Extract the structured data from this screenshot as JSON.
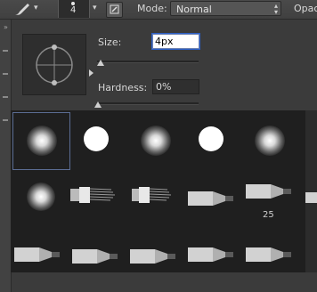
{
  "options_bar": {
    "tool_icon": "brush-icon",
    "brush_size_value": "4",
    "toggle_icon": "brush-panel-toggle-icon",
    "mode_label": "Mode:",
    "mode_value": "Normal",
    "opacity_label": "Opacit"
  },
  "brush_panel": {
    "size_label": "Size:",
    "size_value": "4px",
    "hardness_label": "Hardness:",
    "hardness_value": "0%",
    "size_slider_fraction": 0.02,
    "hardness_slider_fraction": 0.0
  },
  "presets": [
    {
      "type": "soft-round",
      "selected": true
    },
    {
      "type": "hard-round"
    },
    {
      "type": "soft-round"
    },
    {
      "type": "hard-round"
    },
    {
      "type": "soft-round"
    },
    {
      "type": "soft-round"
    },
    {
      "type": "bristle"
    },
    {
      "type": "bristle"
    },
    {
      "type": "pencil"
    },
    {
      "type": "pencil",
      "label": "25"
    },
    {
      "type": "pencil"
    },
    {
      "type": "pencil"
    },
    {
      "type": "pencil"
    },
    {
      "type": "pencil"
    },
    {
      "type": "pencil"
    }
  ],
  "colors": {
    "accent_focus": "#2c60c8",
    "selected_outline": "#5b6d94",
    "panel_bg": "#3b3b3b",
    "presets_bg": "#1f1f1f"
  }
}
